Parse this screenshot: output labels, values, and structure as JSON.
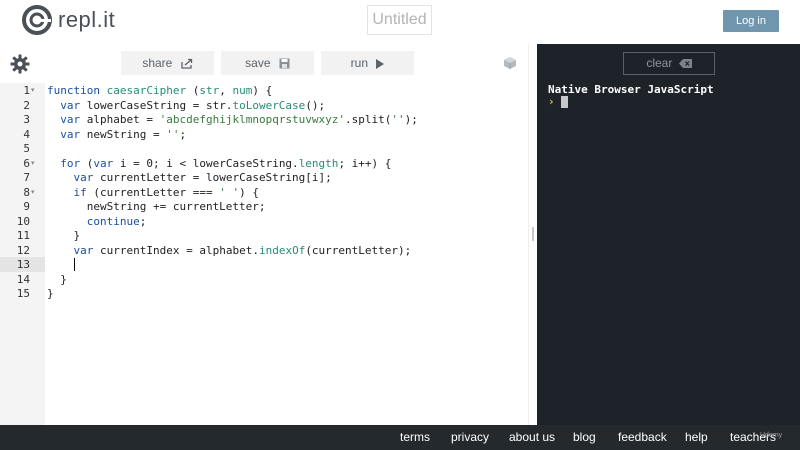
{
  "header": {
    "logo_text": "repl.it",
    "title": "Untitled",
    "login_label": "Log in"
  },
  "toolbar": {
    "share_label": "share",
    "save_label": "save",
    "run_label": "run"
  },
  "editor": {
    "active_line": 13,
    "line_numbers": [
      "1",
      "2",
      "3",
      "4",
      "5",
      "6",
      "7",
      "8",
      "9",
      "10",
      "11",
      "12",
      "13",
      "14",
      "15"
    ]
  },
  "console": {
    "clear_label": "clear",
    "header_text": "Native Browser JavaScript",
    "prompt": "›"
  },
  "footer": {
    "links": [
      "terms",
      "privacy",
      "about us",
      "blog",
      "feedback",
      "help",
      "teachers"
    ],
    "watermark": "Udemy"
  },
  "colors": {
    "console_bg": "#1e2329",
    "footer_bg": "#24292e",
    "login_bg": "#6f96ad",
    "keyword": "#1a4fa0",
    "string": "#3a7a3a",
    "method": "#2a8a78"
  },
  "icons": {
    "gear": "gear-icon",
    "share": "share-icon",
    "save": "save-icon",
    "run": "play-icon",
    "cube": "cube-icon",
    "clear": "backspace-icon"
  }
}
